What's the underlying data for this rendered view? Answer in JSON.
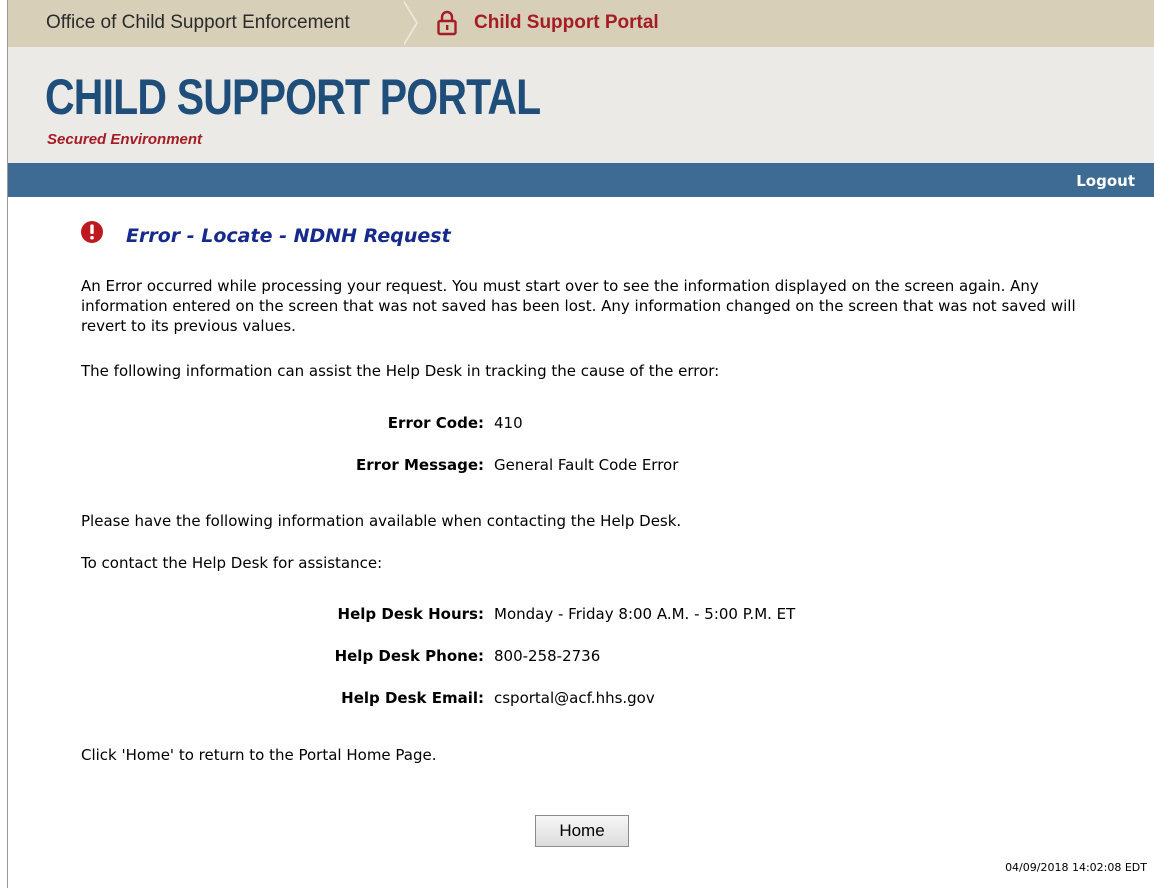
{
  "breadcrumb": {
    "office": "Office of Child Support Enforcement",
    "portal": "Child Support Portal"
  },
  "banner": {
    "title": "CHILD SUPPORT PORTAL",
    "subtitle": "Secured Environment"
  },
  "nav": {
    "logout_label": "Logout"
  },
  "error": {
    "title": "Error - Locate - NDNH Request",
    "intro": "An Error occurred while processing your request. You must start over to see the information displayed on the screen again. Any information entered on the screen that was not saved has been lost. Any information changed on the screen that was not saved will revert to its previous values.",
    "assist_text": "The following information can assist the Help Desk in tracking the cause of the error:",
    "code_label": "Error Code:",
    "code_value": "410",
    "message_label": "Error Message:",
    "message_value": "General Fault Code Error"
  },
  "helpdesk": {
    "available_text": "Please have the following information available when contacting the Help Desk.",
    "contact_text": "To contact the Help Desk for assistance:",
    "hours_label": "Help Desk Hours:",
    "hours_value": "Monday - Friday 8:00 A.M. - 5:00 P.M. ET",
    "phone_label": "Help Desk Phone:",
    "phone_value": "800-258-2736",
    "email_label": "Help Desk Email:",
    "email_value": "csportal@acf.hhs.gov"
  },
  "footer": {
    "home_text": "Click 'Home' to return to the Portal Home Page.",
    "home_button": "Home",
    "timestamp": "04/09/2018 14:02:08 EDT"
  },
  "colors": {
    "brand_blue": "#1f4e7a",
    "brand_red": "#a51c24",
    "nav_blue": "#3d6b93",
    "error_title": "#152a8c"
  },
  "icons": {
    "lock": "lock-icon",
    "error": "error-icon"
  }
}
